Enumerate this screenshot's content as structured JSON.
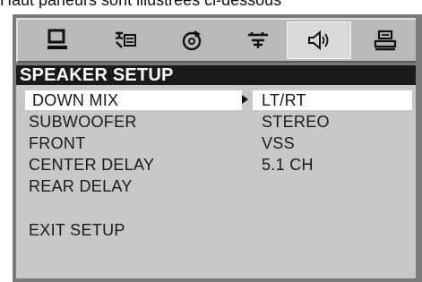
{
  "caption_fragment": "Haut parleurs sont illustrées ci-dessous",
  "icons": [
    {
      "name": "monitor-icon"
    },
    {
      "name": "language-icon"
    },
    {
      "name": "audio-disc-icon"
    },
    {
      "name": "settings-icon"
    },
    {
      "name": "speaker-icon",
      "active": true
    },
    {
      "name": "preference-icon"
    }
  ],
  "title": "SPEAKER SETUP",
  "menu": [
    {
      "label": "DOWN MIX",
      "selected": true
    },
    {
      "label": "SUBWOOFER"
    },
    {
      "label": "FRONT"
    },
    {
      "label": "CENTER DELAY"
    },
    {
      "label": "REAR DELAY"
    },
    {
      "label": "EXIT SETUP"
    }
  ],
  "options": [
    {
      "label": "LT/RT",
      "selected": true
    },
    {
      "label": "STEREO"
    },
    {
      "label": "VSS"
    },
    {
      "label": "5.1 CH"
    }
  ],
  "colors": {
    "frame": "#7a7a7a",
    "panel": "#c7c7c7",
    "title_bar": "#1a1a1a",
    "highlight": "#ffffff"
  }
}
